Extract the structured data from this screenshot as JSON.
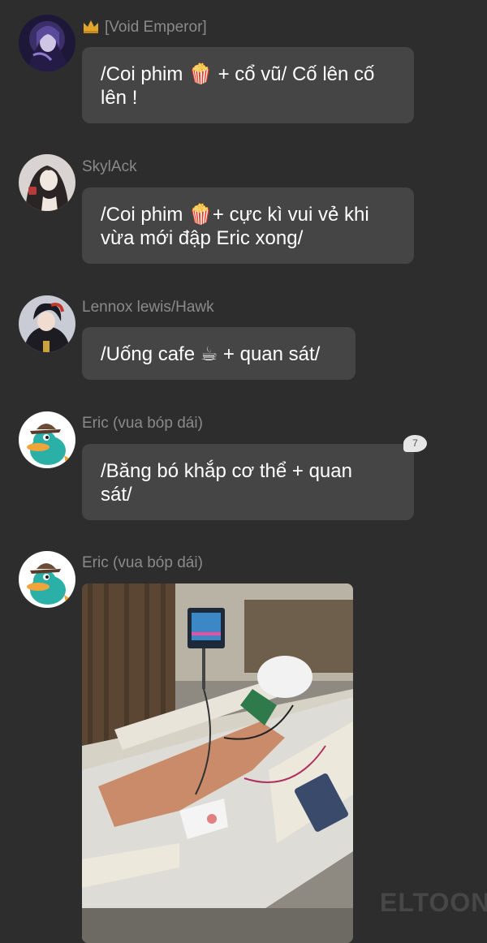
{
  "messages": [
    {
      "author": "[Void Emperor]",
      "author_badge_icon": "crown-icon",
      "text_lines": [
        "/Coi phim 🍿 + cổ vũ/ Cố lên cố",
        "lên !"
      ]
    },
    {
      "author": "SkylAck",
      "text_lines": [
        "/Coi phim 🍿+ cực kì vui vẻ khi",
        "vừa mới đập Eric xong/"
      ]
    },
    {
      "author": "Lennox lewis/Hawk",
      "text_lines": [
        "/Uống cafe ☕ + quan sát/"
      ]
    },
    {
      "author": "Eric (vua bóp dái)",
      "text_lines": [
        "/Băng bó khắp cơ thể + quan",
        "sát/"
      ],
      "reaction_count": "7"
    },
    {
      "author": "Eric (vua bóp dái)",
      "attachment": "hospital-bed-photo"
    }
  ],
  "watermark": "ELTOON",
  "colors": {
    "background": "#2d2d2d",
    "bubble": "#454545",
    "author_name": "#8a8a8a",
    "text": "#ffffff"
  }
}
